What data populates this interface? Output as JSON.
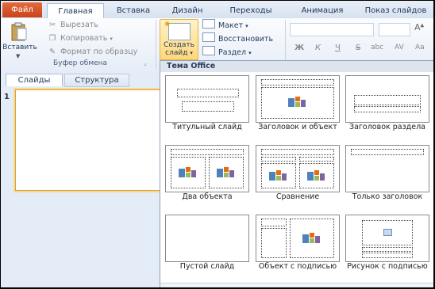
{
  "tabs": {
    "file": "Файл",
    "home": "Главная",
    "insert": "Вставка",
    "design": "Дизайн",
    "transitions": "Переходы",
    "animation": "Анимация",
    "slideshow": "Показ слайдов"
  },
  "clipboard": {
    "paste": "Вставить",
    "cut": "Вырезать",
    "copy": "Копировать",
    "format_painter": "Формат по образцу",
    "group_label": "Буфер обмена"
  },
  "slides_group": {
    "new_slide_line1": "Создать",
    "new_slide_line2": "слайд",
    "layout": "Макет",
    "reset": "Восстановить",
    "section": "Раздел"
  },
  "font_group": {
    "bold": "Ж",
    "italic": "К",
    "underline": "Ч",
    "strike": "S",
    "shadow": "abc",
    "spacing": "AV",
    "grow": "A"
  },
  "left_pane": {
    "tab_slides": "Слайды",
    "tab_outline": "Структура",
    "slide_number": "1"
  },
  "gallery": {
    "title": "Тема Office",
    "layouts": [
      {
        "label": "Титульный слайд"
      },
      {
        "label": "Заголовок и объект"
      },
      {
        "label": "Заголовок раздела"
      },
      {
        "label": "Два объекта"
      },
      {
        "label": "Сравнение"
      },
      {
        "label": "Только заголовок"
      },
      {
        "label": "Пустой слайд"
      },
      {
        "label": "Объект с подписью"
      },
      {
        "label": "Рисунок с подписью"
      }
    ]
  },
  "colors": {
    "file_tab": "#c9431b",
    "ribbon": "#e6edf7",
    "highlight": "#ffd77a",
    "selection_border": "#d9a33c"
  }
}
